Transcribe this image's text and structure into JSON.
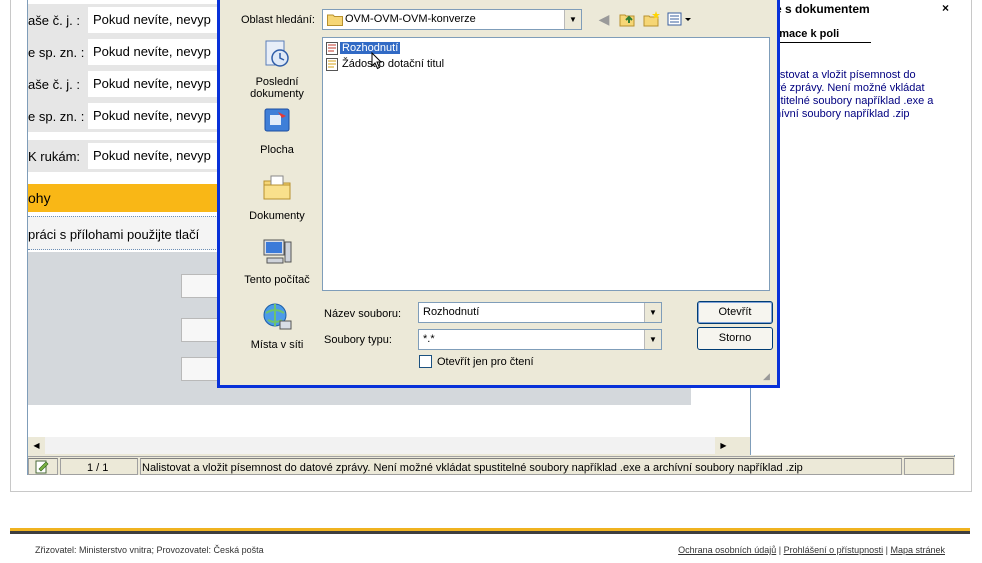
{
  "form": {
    "rows": [
      {
        "label": "aše č. j. :",
        "value": "Pokud nevíte, nevyp"
      },
      {
        "label": "e sp. zn. :",
        "value": "Pokud nevíte, nevyp"
      },
      {
        "label": "aše č. j. :",
        "value": "Pokud nevíte, nevyp"
      },
      {
        "label": "e sp. zn. :",
        "value": "Pokud nevíte, nevyp"
      },
      {
        "label": "K rukám:",
        "value": "Pokud nevíte, nevyp"
      }
    ],
    "section_title": "ohy",
    "hint": "práci s přílohami použijte tlačí"
  },
  "right_pane": {
    "title": "e s dokumentem",
    "close": "×",
    "subtitle": "rmace k poli",
    "text": "listovat a vložit písemnost do\nvé zprávy. Není možné vkládat\nstitelné soubory například .exe a\nhívní soubory například .zip"
  },
  "status_bar": {
    "page": "1 / 1",
    "message": "Nalistovat a vložit písemnost do datové zprávy. Není možné vkládat spustitelné soubory například .exe a archívní soubory například .zip"
  },
  "dialog": {
    "look_in_label": "Oblast hledání:",
    "look_in_value": "OVM-OVM-OVM-konverze",
    "places": [
      {
        "label": "Poslední dokumenty",
        "icon": "recent-documents-icon"
      },
      {
        "label": "Plocha",
        "icon": "desktop-icon"
      },
      {
        "label": "Dokumenty",
        "icon": "documents-folder-icon"
      },
      {
        "label": "Tento počítač",
        "icon": "my-computer-icon"
      },
      {
        "label": "Místa v síti",
        "icon": "network-places-icon"
      }
    ],
    "files": [
      {
        "name": "Rozhodnutí",
        "selected": true
      },
      {
        "name": "Žádost o dotační titul",
        "selected": false
      }
    ],
    "filename_label": "Název souboru:",
    "filename_value": "Rozhodnutí",
    "filetype_label": "Soubory typu:",
    "filetype_value": "*.*",
    "readonly_label": "Otevřít jen pro čtení",
    "open_button": "Otevřít",
    "cancel_button": "Storno"
  },
  "footer": {
    "left": "Zřizovatel: Ministerstvo vnitra; Provozovatel: Česká pošta",
    "links": [
      "Ochrana osobních údajů",
      "Prohlášení o přístupnosti",
      "Mapa stránek"
    ],
    "separator": " | "
  },
  "colors": {
    "dialog_border": "#0831d9",
    "selection": "#316ac5",
    "section_bar": "#f9b716",
    "window_face": "#ece9d8"
  }
}
